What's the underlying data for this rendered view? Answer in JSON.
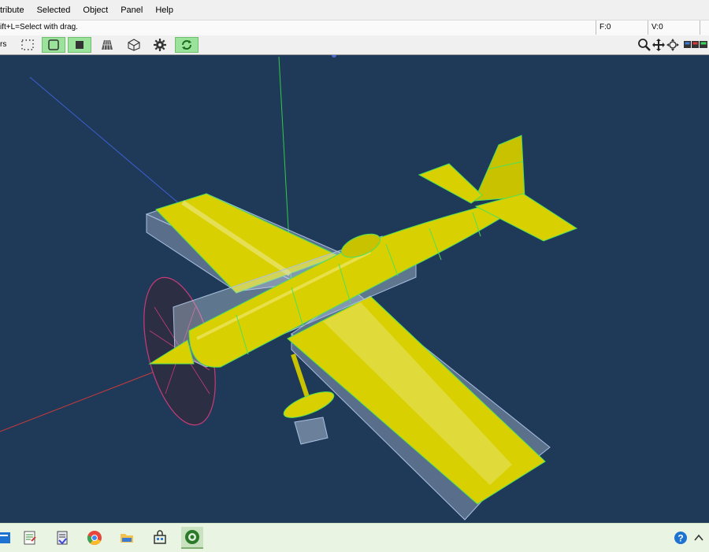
{
  "menubar": {
    "items": [
      "tribute",
      "Selected",
      "Object",
      "Panel",
      "Help"
    ]
  },
  "statusbar": {
    "message": "ift+L=Select with drag.",
    "frame": "F:0",
    "vertex": "V:0"
  },
  "toolbar": {
    "left_label": "rs",
    "buttons": [
      {
        "icon": "select-dotted-icon",
        "active": false
      },
      {
        "icon": "select-frame-icon",
        "active": true
      },
      {
        "icon": "solid-square-icon",
        "active": true
      },
      {
        "icon": "mesh-wire-icon",
        "active": false
      },
      {
        "icon": "cube-icon",
        "active": false
      },
      {
        "icon": "gear-icon",
        "active": false
      },
      {
        "icon": "refresh-icon",
        "active": true
      }
    ],
    "right_icons": [
      "zoom-icon",
      "move-icon",
      "rotate-icon",
      "view-options-icon"
    ]
  },
  "viewport": {
    "background": "#1f3a58",
    "model_color": "#d8d000",
    "wire_color": "#4ee05a"
  },
  "taskbar": {
    "icons": [
      "windows-app-icon",
      "notepad-icon",
      "document-icon",
      "chrome-icon",
      "file-explorer-icon",
      "store-icon",
      "modeler-app-icon"
    ],
    "tray_icons": [
      "help-icon",
      "chevron-up-icon"
    ]
  }
}
